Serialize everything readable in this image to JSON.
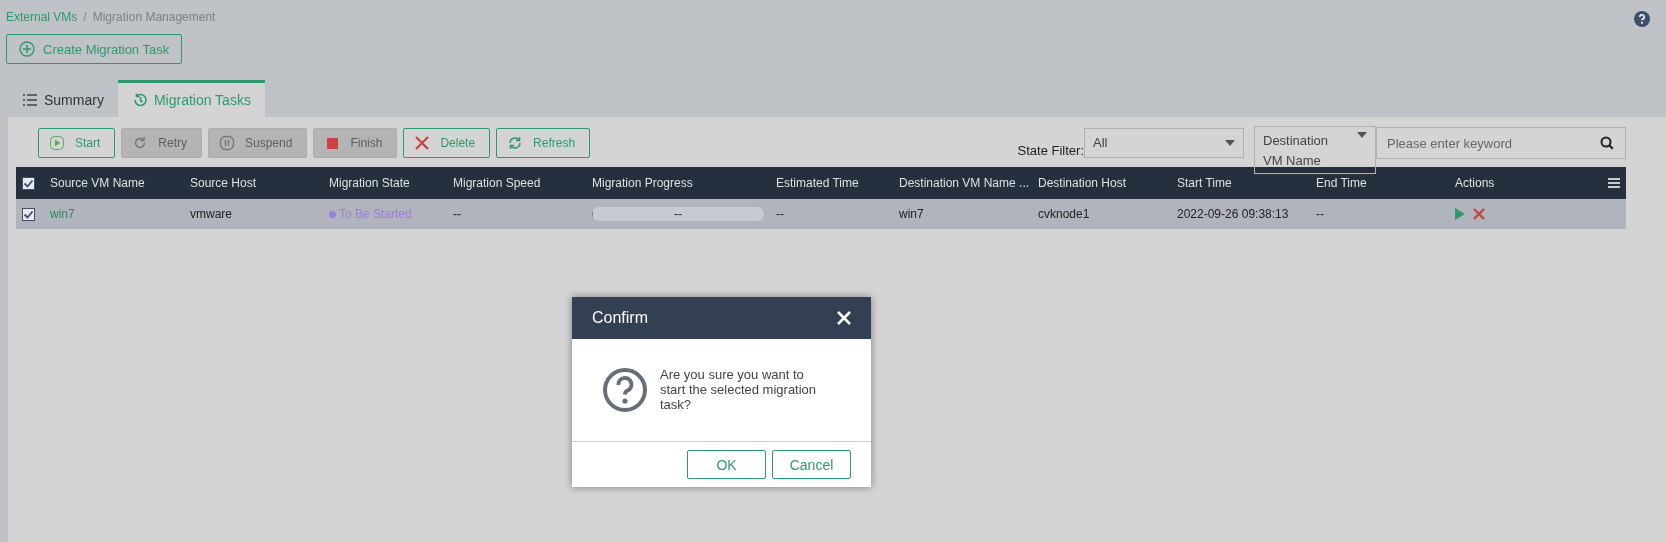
{
  "breadcrumb": {
    "separator": "/",
    "items": [
      {
        "label": "External VMs",
        "link": true
      },
      {
        "label": "Migration Management",
        "link": false
      }
    ]
  },
  "create_button": {
    "label": "Create Migration Task"
  },
  "tabs": [
    {
      "label": "Summary",
      "selected": false,
      "kind": "list"
    },
    {
      "label": "Migration Tasks",
      "selected": true,
      "kind": "history"
    }
  ],
  "toolbar": [
    {
      "label": "Start",
      "kind": "play",
      "disabled": false
    },
    {
      "label": "Retry",
      "kind": "retry",
      "disabled": true
    },
    {
      "label": "Suspend",
      "kind": "pause",
      "disabled": true
    },
    {
      "label": "Finish",
      "kind": "stop",
      "disabled": true
    },
    {
      "label": "Delete",
      "kind": "x",
      "disabled": false
    },
    {
      "label": "Refresh",
      "kind": "refresh",
      "disabled": false
    }
  ],
  "state_filter": {
    "label": "State Filter:",
    "value": "All"
  },
  "search": {
    "field": "Destination VM Name",
    "placeholder": "Please enter keyword"
  },
  "table": {
    "all_checked": true,
    "columns": [
      "Source VM Name",
      "Source Host",
      "Migration State",
      "Migration Speed",
      "Migration Progress",
      "Estimated Time",
      "Destination VM Name ...",
      "Destination Host",
      "Start Time",
      "End Time",
      "Actions"
    ],
    "rows": [
      {
        "checked": true,
        "source_vm": "win7",
        "source_host": "vmware",
        "state": "To Be Started",
        "color": "#9b7fd8",
        "speed": "--",
        "progress": {
          "level": 0,
          "reading": "--"
        },
        "estimated": "--",
        "dest_vm": "win7",
        "dest_host": "cvknode1",
        "start_time": "2022-09-26 09:38:13",
        "end_time": "--"
      }
    ]
  },
  "dialog": {
    "title": "Confirm",
    "message": "Are you sure you want to start the selected migration task?",
    "buttons": [
      "OK",
      "Cancel"
    ]
  }
}
